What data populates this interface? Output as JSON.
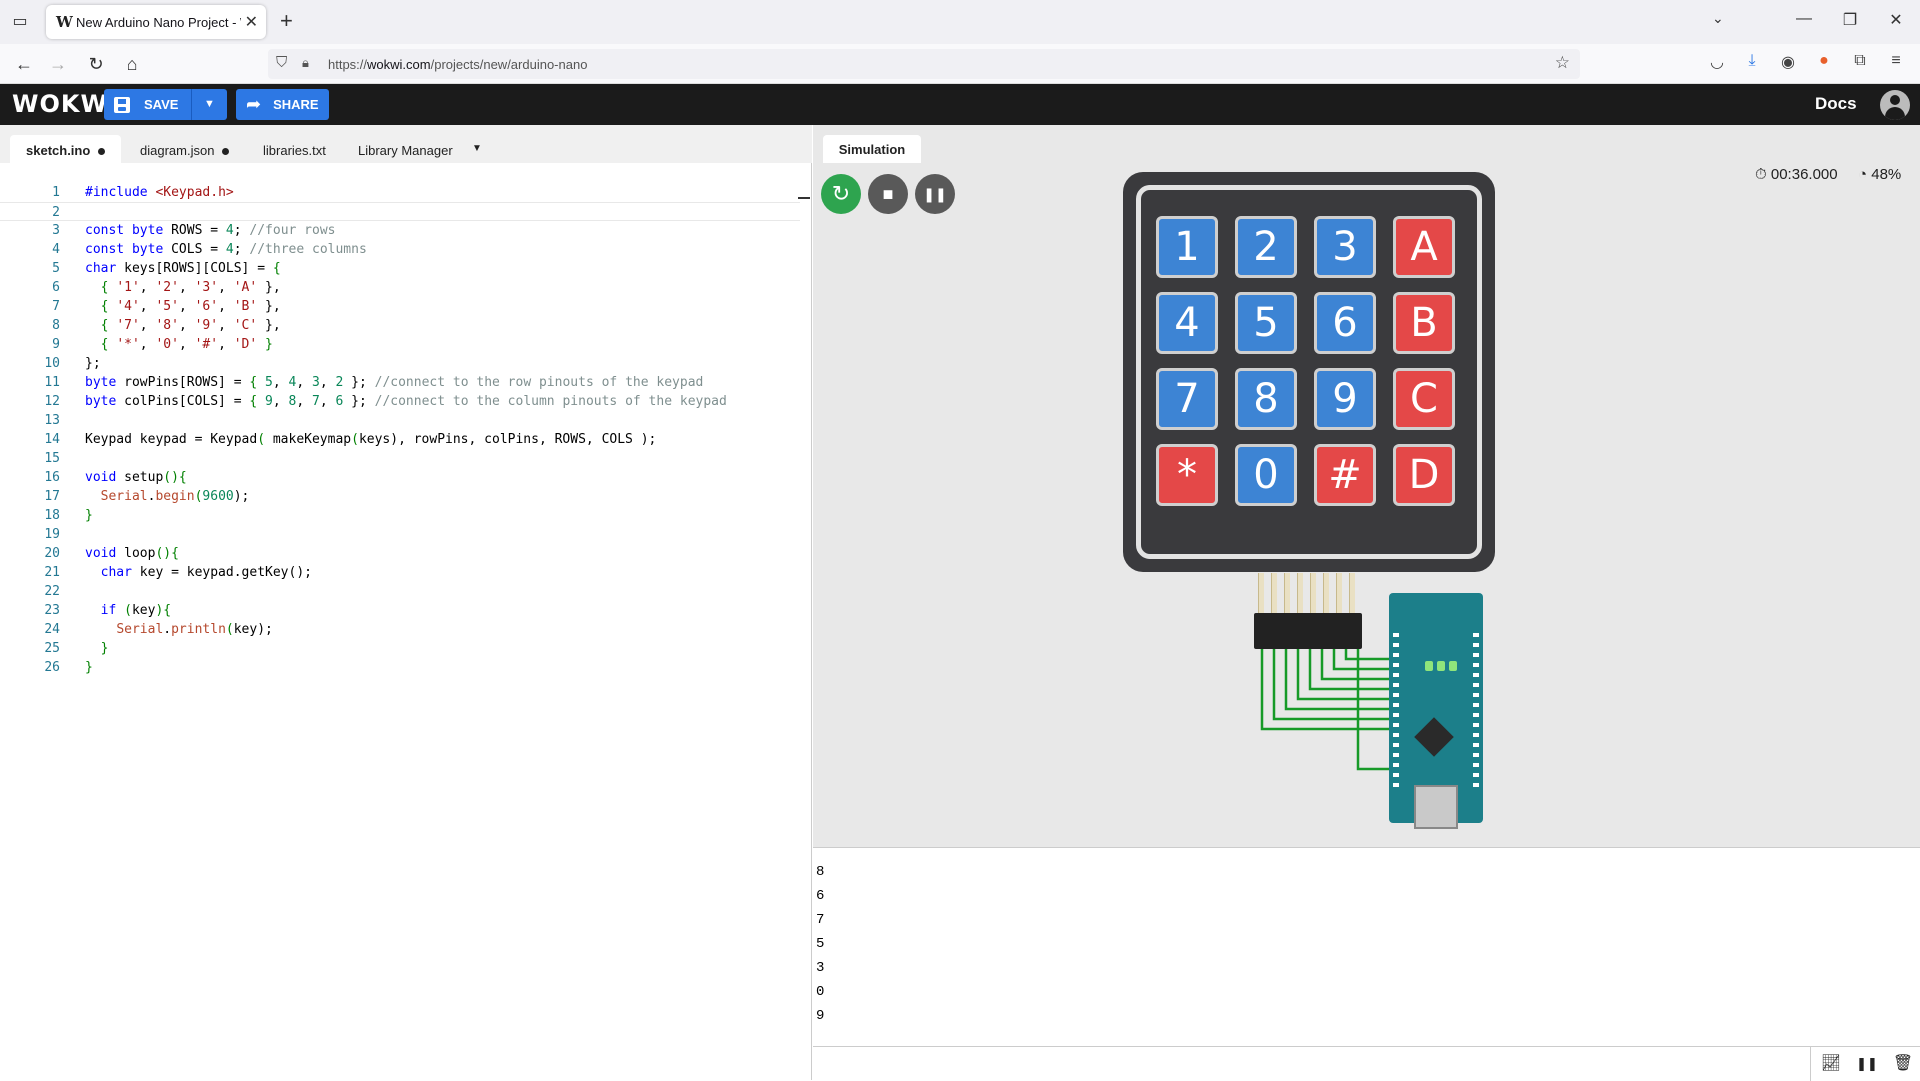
{
  "browser": {
    "tab_title": "New Arduino Nano Project - Wokwi",
    "tab_favicon": "W",
    "url_prefix": "https://",
    "url_domain": "wokwi.com",
    "url_path": "/projects/new/arduino-nano"
  },
  "header": {
    "logo": "WOKWi",
    "save_label": "SAVE",
    "share_label": "SHARE",
    "docs_label": "Docs"
  },
  "editor": {
    "tabs": [
      {
        "label": "sketch.ino",
        "modified": true
      },
      {
        "label": "diagram.json",
        "modified": true
      },
      {
        "label": "libraries.txt",
        "modified": false
      },
      {
        "label": "Library Manager",
        "modified": false
      }
    ],
    "code_lines": [
      "#include <Keypad.h>",
      "",
      "const byte ROWS = 4; //four rows",
      "const byte COLS = 4; //three columns",
      "char keys[ROWS][COLS] = {",
      "  { '1', '2', '3', 'A' },",
      "  { '4', '5', '6', 'B' },",
      "  { '7', '8', '9', 'C' },",
      "  { '*', '0', '#', 'D' }",
      "};",
      "byte rowPins[ROWS] = { 5, 4, 3, 2 }; //connect to the row pinouts of the keypad",
      "byte colPins[COLS] = { 9, 8, 7, 6 }; //connect to the column pinouts of the keypad",
      "",
      "Keypad keypad = Keypad( makeKeymap(keys), rowPins, colPins, ROWS, COLS );",
      "",
      "void setup(){",
      "  Serial.begin(9600);",
      "}",
      "",
      "void loop(){",
      "  char key = keypad.getKey();",
      "",
      "  if (key){",
      "    Serial.println(key);",
      "  }",
      "}"
    ]
  },
  "simulation": {
    "tab_label": "Simulation",
    "timer": "00:36.000",
    "speed": "48%",
    "keypad": {
      "keys": [
        [
          "1",
          "2",
          "3",
          "A"
        ],
        [
          "4",
          "5",
          "6",
          "B"
        ],
        [
          "7",
          "8",
          "9",
          "C"
        ],
        [
          "*",
          "0",
          "#",
          "D"
        ]
      ],
      "red_keys": [
        "A",
        "B",
        "C",
        "D",
        "*",
        "#"
      ],
      "blue_color": "#3d84d4",
      "red_color": "#e44848"
    },
    "icons": {
      "restart": "↻",
      "stop": "■",
      "pause": "❚❚"
    }
  },
  "serial": {
    "output": [
      "8",
      "6",
      "7",
      "5",
      "3",
      "0",
      "9"
    ],
    "input_placeholder": ""
  }
}
